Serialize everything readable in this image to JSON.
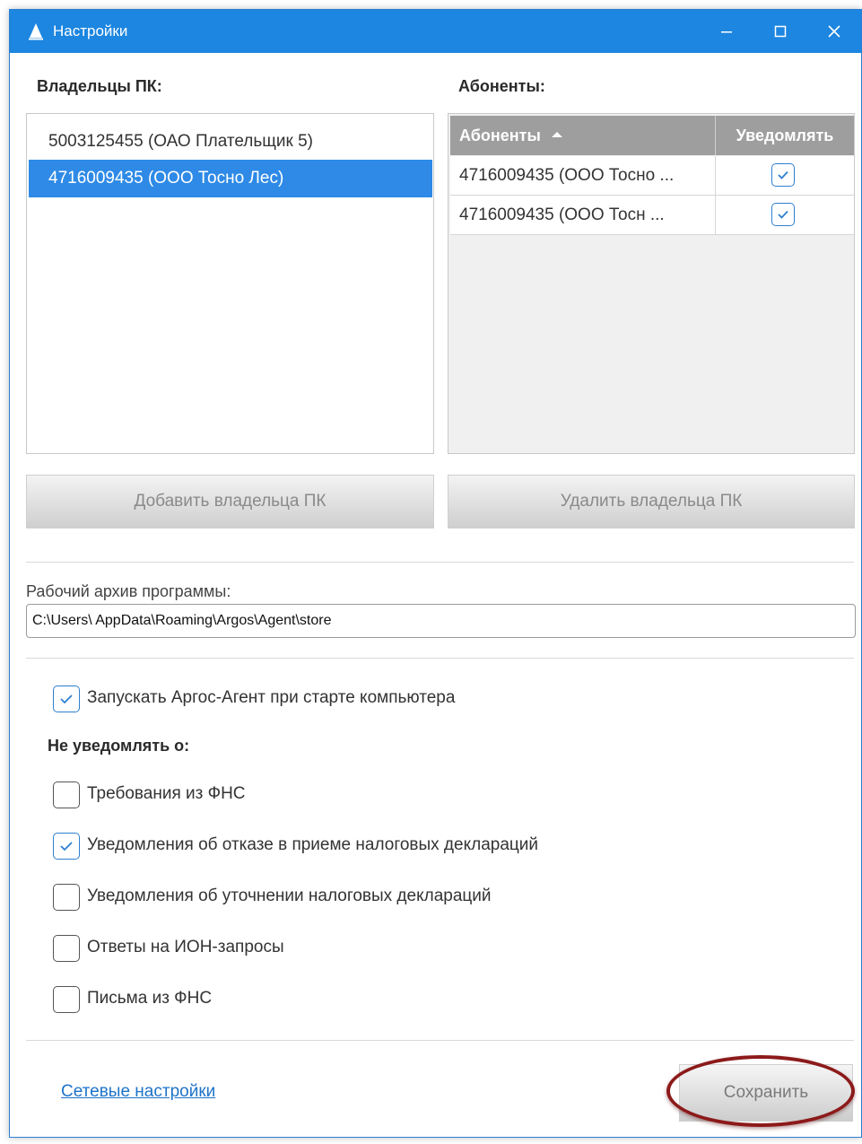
{
  "window": {
    "title": "Настройки"
  },
  "owners": {
    "label": "Владельцы ПК:",
    "items": [
      {
        "label": "5003125455 (ОАО Плательщик 5)",
        "selected": false
      },
      {
        "label": "4716009435 (ООО Тосно Лес)",
        "selected": true
      }
    ]
  },
  "subscribers": {
    "label": "Абоненты:",
    "columns": [
      "Абоненты",
      "Уведомлять"
    ],
    "rows": [
      {
        "name": "4716009435 (ООО Тосно ...",
        "notify": true
      },
      {
        "name": "4716009435 (ООО Тосн ...",
        "notify": true
      }
    ]
  },
  "buttons": {
    "add_owner": "Добавить владельца ПК",
    "remove_owner": "Удалить владельца ПК",
    "save": "Сохранить"
  },
  "archive": {
    "label": "Рабочий архив программы:",
    "value": "C:\\Users\\ AppData\\Roaming\\Argos\\Agent\\store"
  },
  "startup": {
    "label": "Запускать Аргос-Агент при старте компьютера",
    "checked": true
  },
  "no_notify": {
    "label": "Не уведомлять о:",
    "options": [
      {
        "label": "Требования из ФНС",
        "checked": false
      },
      {
        "label": "Уведомления об отказе в приеме налоговых деклараций",
        "checked": true
      },
      {
        "label": "Уведомления об уточнении налоговых деклараций",
        "checked": false
      },
      {
        "label": "Ответы на ИОН-запросы",
        "checked": false
      },
      {
        "label": "Письма из ФНС",
        "checked": false
      }
    ]
  },
  "network_link": "Сетевые настройки",
  "colors": {
    "titlebar": "#1c86e0",
    "selection": "#2e8ae6",
    "table_header": "#9e9e9e",
    "highlight_ring": "#8c1a1a"
  }
}
